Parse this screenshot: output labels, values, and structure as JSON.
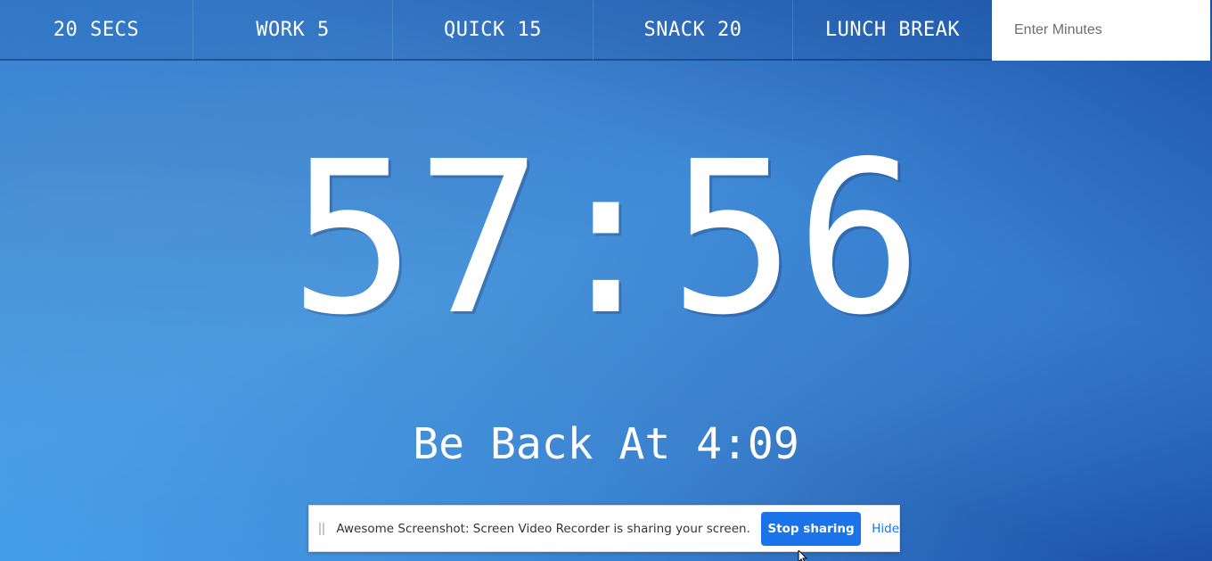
{
  "presets": [
    {
      "label": "20 SECS"
    },
    {
      "label": "WORK 5"
    },
    {
      "label": "QUICK 15"
    },
    {
      "label": "SNACK 20"
    },
    {
      "label": "LUNCH BREAK"
    }
  ],
  "minutes_input": {
    "placeholder": "Enter Minutes",
    "value": ""
  },
  "timer": {
    "display": "57:56"
  },
  "be_back": {
    "text": "Be Back At 4:09"
  },
  "share_bar": {
    "message": "Awesome Screenshot: Screen Video Recorder is sharing your screen.",
    "stop_label": "Stop sharing",
    "hide_label": "Hide"
  },
  "colors": {
    "accent": "#1a73e8",
    "background_light": "#45a8f2",
    "background_dark": "#1a4fa5"
  },
  "icons": {
    "grip": "drag-handle-icon",
    "cursor": "mouse-pointer-icon"
  }
}
